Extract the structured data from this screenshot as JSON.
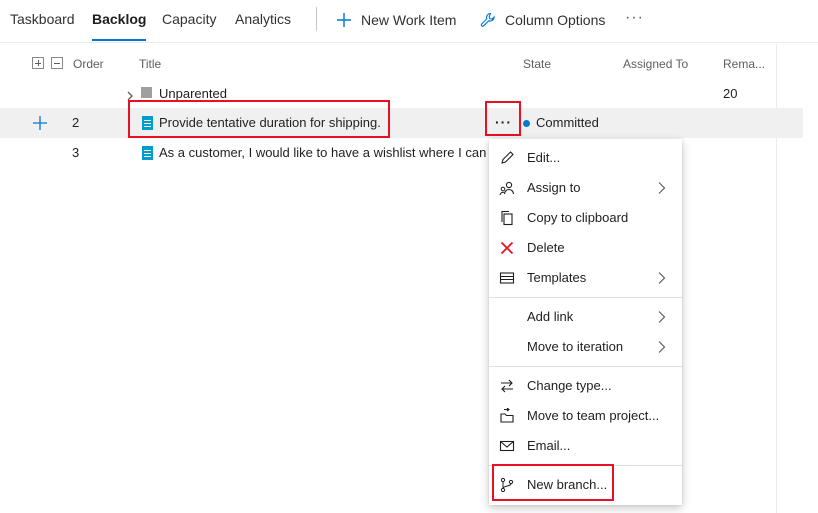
{
  "nav": {
    "tabs": [
      {
        "label": "Taskboard"
      },
      {
        "label": "Backlog",
        "active": true
      },
      {
        "label": "Capacity"
      },
      {
        "label": "Analytics"
      }
    ],
    "new_work_item": "New Work Item",
    "column_options": "Column Options",
    "more": "···"
  },
  "grid": {
    "headers": {
      "order": "Order",
      "title": "Title",
      "state": "State",
      "assigned_to": "Assigned To",
      "remaining": "Rema..."
    },
    "unparented": {
      "title": "Unparented",
      "remaining": "20"
    },
    "rows": [
      {
        "order": "2",
        "title": "Provide tentative duration for shipping.",
        "state": "Committed"
      },
      {
        "order": "3",
        "title": "As a customer, I would like to have a wishlist where I can a"
      }
    ],
    "row_more": "···"
  },
  "context_menu": {
    "items": [
      {
        "label": "Edit...",
        "icon": "pencil-icon"
      },
      {
        "label": "Assign to",
        "icon": "assign-people-icon",
        "submenu": true
      },
      {
        "label": "Copy to clipboard",
        "icon": "copy-icon"
      },
      {
        "label": "Delete",
        "icon": "delete-x-icon"
      },
      {
        "label": "Templates",
        "icon": "template-icon",
        "submenu": true
      },
      {
        "label": "Add link",
        "submenu": true
      },
      {
        "label": "Move to iteration",
        "submenu": true
      },
      {
        "label": "Change type...",
        "icon": "swap-arrows-icon"
      },
      {
        "label": "Move to team project...",
        "icon": "move-project-icon"
      },
      {
        "label": "Email...",
        "icon": "mail-icon"
      },
      {
        "label": "New branch...",
        "icon": "branch-icon"
      }
    ]
  },
  "colors": {
    "accent": "#0078d4",
    "highlight": "#e81123",
    "work_item": "#009ccc",
    "delete": "#e81123"
  }
}
